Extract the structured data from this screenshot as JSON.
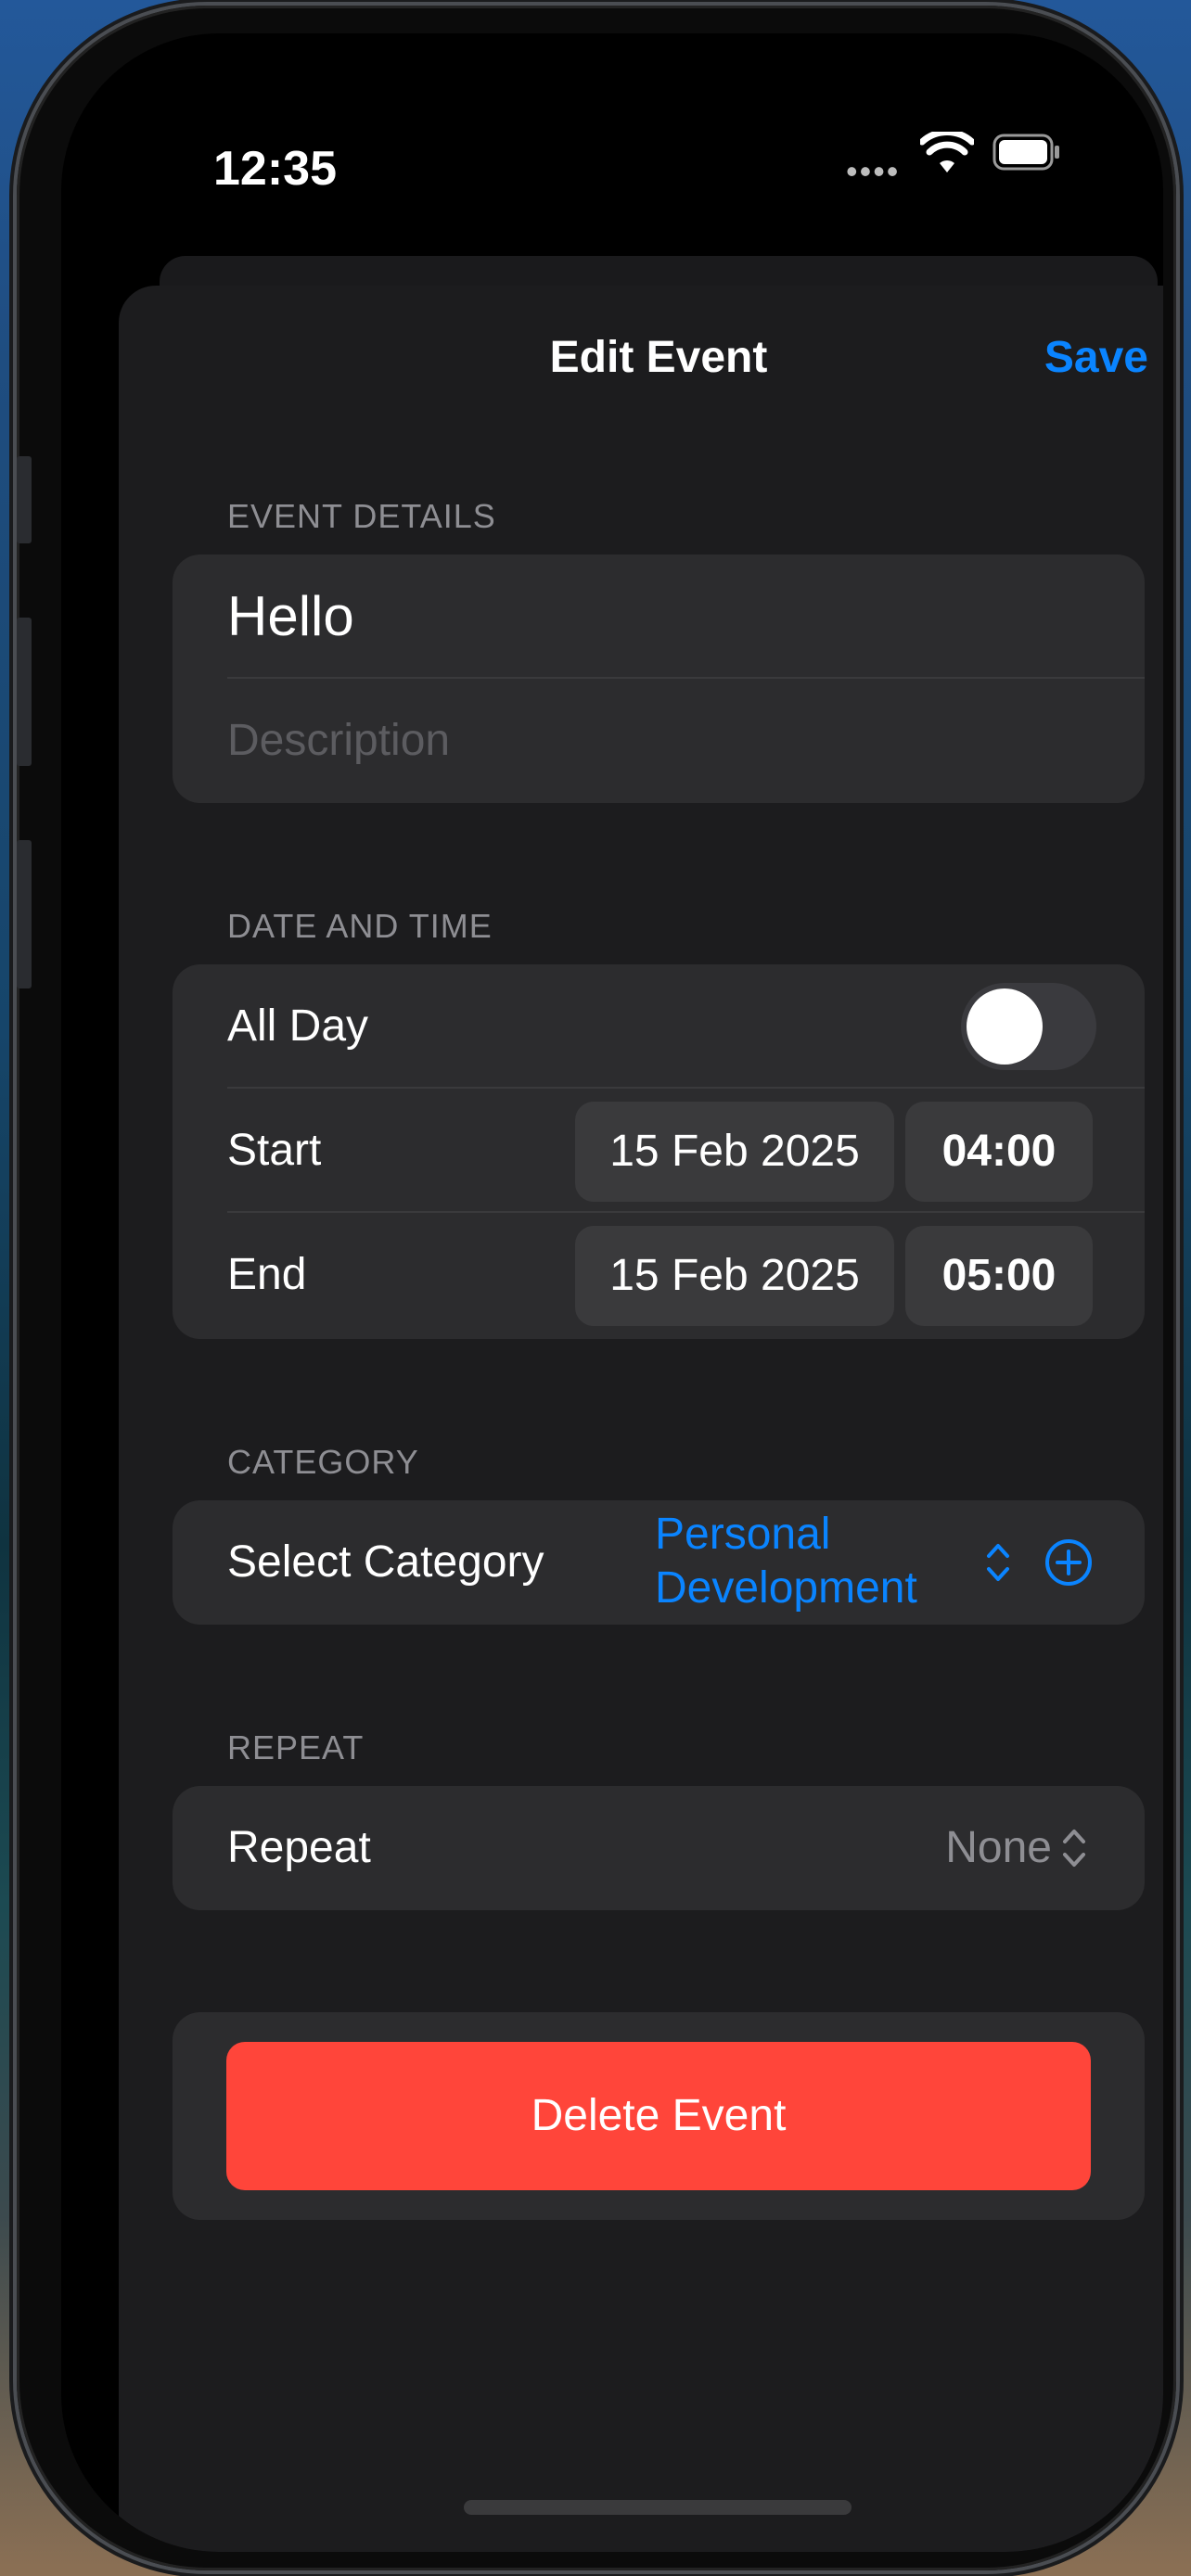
{
  "status_bar": {
    "time": "12:35",
    "signal": "••••"
  },
  "nav": {
    "title": "Edit Event",
    "save_label": "Save"
  },
  "event_details": {
    "header": "EVENT DETAILS",
    "title_value": "Hello",
    "description_placeholder": "Description"
  },
  "date_time": {
    "header": "DATE AND TIME",
    "all_day_label": "All Day",
    "all_day_on": false,
    "start_label": "Start",
    "start_date": "15 Feb 2025",
    "start_time": "04:00",
    "end_label": "End",
    "end_date": "15 Feb 2025",
    "end_time": "05:00"
  },
  "category": {
    "header": "CATEGORY",
    "label": "Select Category",
    "value": "Personal Development"
  },
  "repeat": {
    "header": "REPEAT",
    "label": "Repeat",
    "value": "None"
  },
  "delete": {
    "label": "Delete Event"
  },
  "colors": {
    "accent": "#0a84ff",
    "destructive": "#ff453a",
    "sheet_bg": "#1c1c1e",
    "group_bg": "#2c2c2e",
    "secondary_text": "#8e8e93"
  },
  "icons": [
    "wifi-icon",
    "battery-icon",
    "chevron-up-down-icon",
    "plus-circle-icon"
  ]
}
